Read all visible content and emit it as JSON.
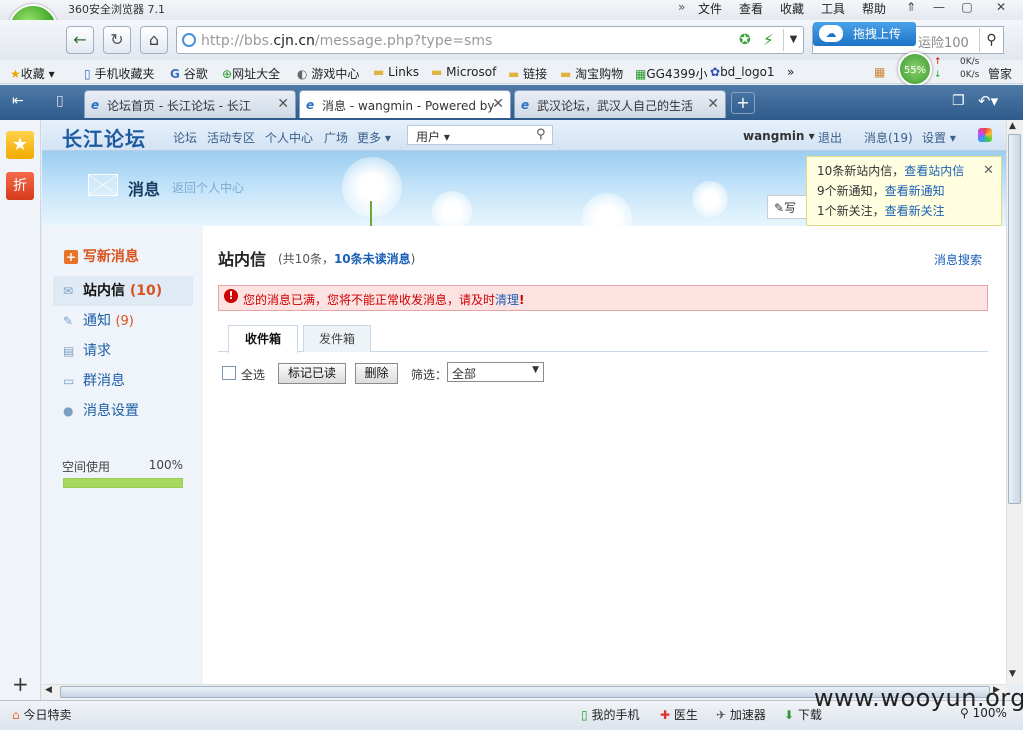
{
  "browser": {
    "title": "360安全浏览器 7.1",
    "menu": [
      "文件",
      "查看",
      "收藏",
      "工具",
      "帮助"
    ],
    "url_prefix": "http://bbs.",
    "url_domain": "cjn.cn",
    "url_suffix": "/message.php?type=sms",
    "upload_label": "拖拽上传",
    "search_text": "运险100",
    "speed_pct": "55%",
    "speed_up": "0K/s",
    "speed_down": "0K/s"
  },
  "bookmarks": [
    "收藏",
    "手机收藏夹",
    "谷歌",
    "网址大全",
    "游戏中心",
    "Links",
    "Microsof",
    "链接",
    "淘宝购物",
    "GG4399小",
    "bd_logo1",
    "管家"
  ],
  "tabs": [
    {
      "label": "论坛首页 - 长江论坛 - 长江"
    },
    {
      "label": "消息 - wangmin - Powered by"
    },
    {
      "label": "武汉论坛，武汉人自己的生活"
    }
  ],
  "site": {
    "name": "长江论坛",
    "nav": [
      "论坛",
      "活动专区",
      "个人中心",
      "广场",
      "更多"
    ],
    "user_select": "用户",
    "username": "wangmin",
    "logout": "退出",
    "messages": "消息(19)",
    "settings": "设置"
  },
  "banner": {
    "title": "消息",
    "back_link": "返回个人中心",
    "write_label": "写"
  },
  "popup": {
    "line1_prefix": "10条新站内信，",
    "line1_link": "查看站内信",
    "line2_prefix": "9个新通知，",
    "line2_link": "查看新通知",
    "line3_prefix": "1个新关注，",
    "line3_link": "查看新关注"
  },
  "leftmenu": {
    "new_message": "写新消息",
    "items": [
      {
        "label": "站内信",
        "count": "(10)"
      },
      {
        "label": "通知",
        "count": "(9)"
      },
      {
        "label": "请求",
        "count": ""
      },
      {
        "label": "群消息",
        "count": ""
      },
      {
        "label": "消息设置",
        "count": ""
      }
    ],
    "space_label": "空间使用",
    "space_value": "100%",
    "space_fraction": 1.0
  },
  "main": {
    "title": "站内信",
    "stats_prefix": "(共10条，",
    "stats_unread": "10条未读消息",
    "stats_suffix": ")",
    "search_link": "消息搜索",
    "alert_text": "您的消息已满，您将不能正常收发消息，请及时",
    "alert_link": "清理",
    "tabs": [
      "收件箱",
      "发件箱"
    ],
    "select_all": "全选",
    "mark_read": "标记已读",
    "delete": "删除",
    "filter_label": "筛选：",
    "filter_value": "全部"
  },
  "statusbar": {
    "left": "今日特卖",
    "items": [
      "我的手机",
      "医生",
      "加速器",
      "下载"
    ],
    "zoom": "100%"
  },
  "watermark": "www.wooyun.org"
}
